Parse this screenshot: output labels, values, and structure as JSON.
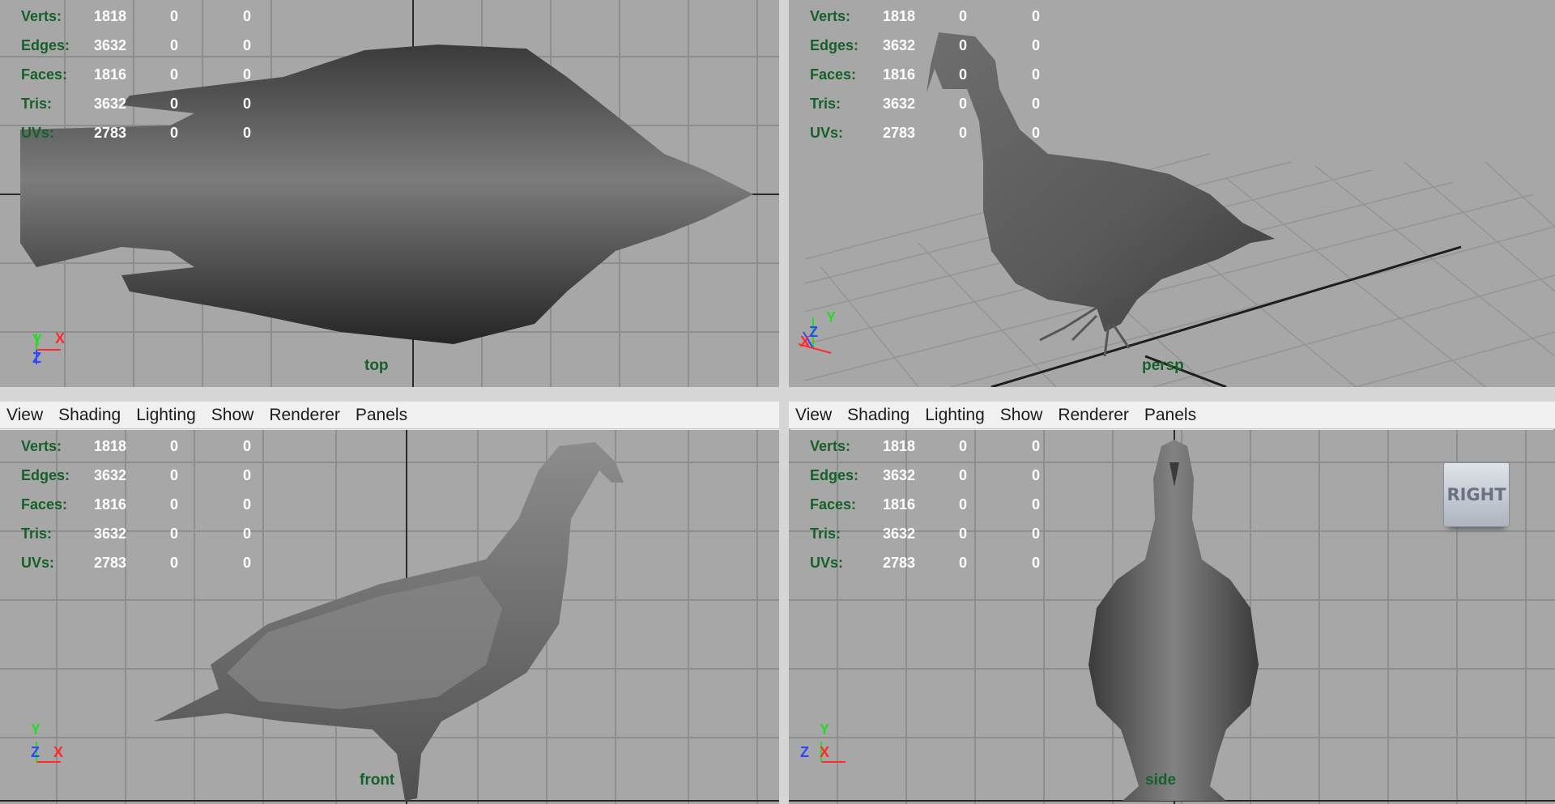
{
  "menu": [
    "View",
    "Shading",
    "Lighting",
    "Show",
    "Renderer",
    "Panels"
  ],
  "hud": {
    "labels": [
      "Verts:",
      "Edges:",
      "Faces:",
      "Tris:",
      "UVs:"
    ],
    "values": [
      [
        "1818",
        "0",
        "0"
      ],
      [
        "3632",
        "0",
        "0"
      ],
      [
        "1816",
        "0",
        "0"
      ],
      [
        "3632",
        "0",
        "0"
      ],
      [
        "2783",
        "0",
        "0"
      ]
    ]
  },
  "panes": {
    "top": {
      "camera": "top"
    },
    "persp": {
      "camera": "persp"
    },
    "front": {
      "camera": "front"
    },
    "side": {
      "camera": "side",
      "viewcube": "RIGHT"
    }
  },
  "axes": {
    "top": [
      "Y",
      "X",
      "Z"
    ],
    "persp": [
      "Y",
      "Z",
      "X"
    ],
    "front": [
      "Y",
      "Z",
      "X"
    ],
    "side": [
      "Y",
      "Z",
      "X"
    ]
  },
  "colors": {
    "axis_x": "#ff2a2a",
    "axis_y": "#22dd22",
    "axis_z": "#2a48ff",
    "hud_label": "#16612a",
    "viewport_bg": "#a7a7a7",
    "selection": "#7aa7d8"
  }
}
